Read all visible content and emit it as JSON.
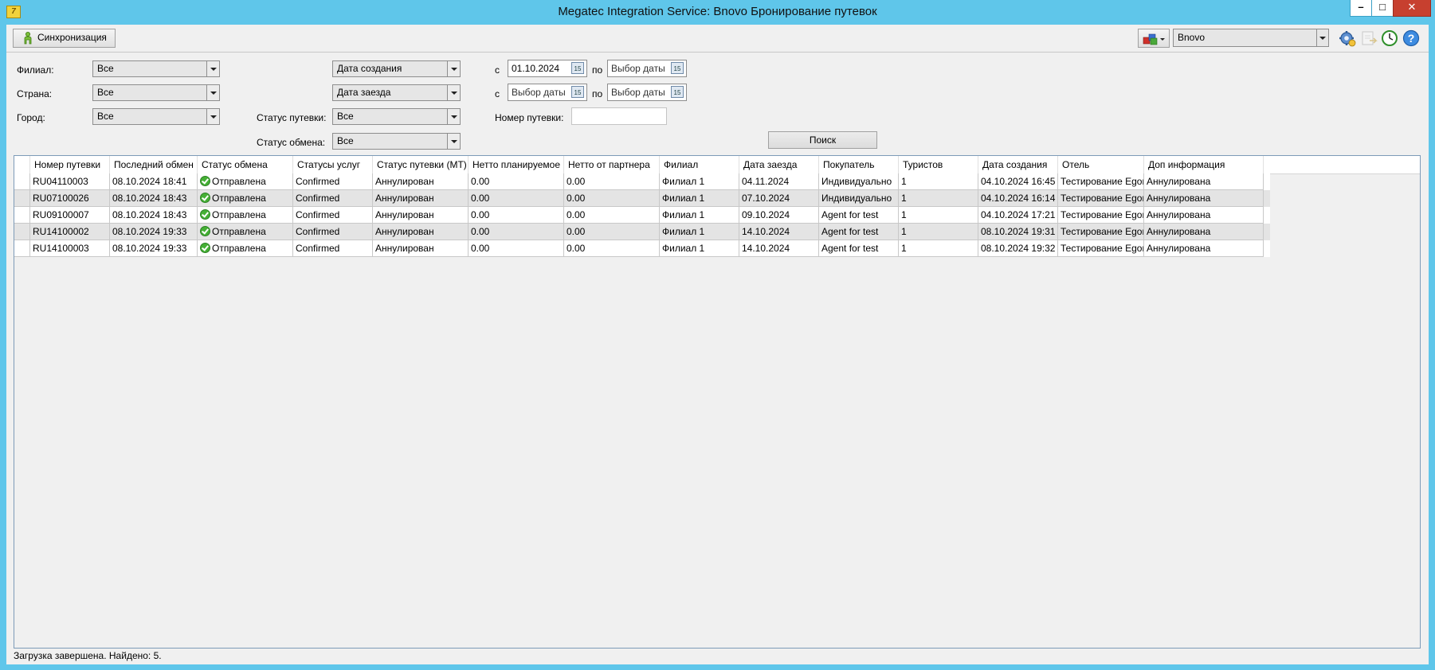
{
  "window": {
    "title": "Megatec Integration Service: Bnovo Бронирование путевок",
    "app_icon_glyph": "7",
    "minimize_glyph": "–",
    "maximize_glyph": "□",
    "close_glyph": "✕"
  },
  "toolbar": {
    "sync_label": "Синхронизация",
    "service_select": "Bnovo"
  },
  "filters": {
    "branch_label": "Филиал:",
    "branch_value": "Все",
    "country_label": "Страна:",
    "country_value": "Все",
    "city_label": "Город:",
    "city_value": "Все",
    "date_type1_value": "Дата создания",
    "date_type2_value": "Дата заезда",
    "tour_status_label": "Статус путевки:",
    "tour_status_value": "Все",
    "exchange_status_label": "Статус обмена:",
    "exchange_status_value": "Все",
    "from_label": "с",
    "to_label": "по",
    "date1_from": "01.10.2024",
    "date1_to": "Выбор даты",
    "date2_from": "Выбор даты",
    "date2_to": "Выбор даты",
    "calendar_glyph": "15",
    "tour_number_label": "Номер путевки:",
    "tour_number_value": "",
    "search_label": "Поиск"
  },
  "grid": {
    "columns": [
      "Номер путевки",
      "Последний обмен",
      "Статус обмена",
      "Статусы услуг",
      "Статус путевки (МТ)",
      "Нетто планируемое",
      "Нетто от партнера",
      "Филиал",
      "Дата заезда",
      "Покупатель",
      "Туристов",
      "Дата создания",
      "Отель",
      "Доп информация"
    ],
    "rows": [
      [
        "RU04110003",
        "08.10.2024 18:41",
        "Отправлена",
        "Confirmed",
        "Аннулирован",
        "0.00",
        "0.00",
        "Филиал 1",
        "04.11.2024",
        "Индивидуально",
        "1",
        "04.10.2024 16:45",
        "Тестирование Egor",
        "Аннулирована"
      ],
      [
        "RU07100026",
        "08.10.2024 18:43",
        "Отправлена",
        "Confirmed",
        "Аннулирован",
        "0.00",
        "0.00",
        "Филиал 1",
        "07.10.2024",
        "Индивидуально",
        "1",
        "04.10.2024 16:14",
        "Тестирование Egor",
        "Аннулирована"
      ],
      [
        "RU09100007",
        "08.10.2024 18:43",
        "Отправлена",
        "Confirmed",
        "Аннулирован",
        "0.00",
        "0.00",
        "Филиал 1",
        "09.10.2024",
        "Agent for test",
        "1",
        "04.10.2024 17:21",
        "Тестирование Egor",
        "Аннулирована"
      ],
      [
        "RU14100002",
        "08.10.2024 19:33",
        "Отправлена",
        "Confirmed",
        "Аннулирован",
        "0.00",
        "0.00",
        "Филиал 1",
        "14.10.2024",
        "Agent for test",
        "1",
        "08.10.2024 19:31",
        "Тестирование Egor",
        "Аннулирована"
      ],
      [
        "RU14100003",
        "08.10.2024 19:33",
        "Отправлена",
        "Confirmed",
        "Аннулирован",
        "0.00",
        "0.00",
        "Филиал 1",
        "14.10.2024",
        "Agent for test",
        "1",
        "08.10.2024 19:32",
        "Тестирование Egor",
        "Аннулирована"
      ]
    ]
  },
  "status_bar": {
    "text": "Загрузка завершена. Найдено: 5."
  },
  "icons": {
    "app": "megatec-app-icon",
    "sync": "sync-person-icon",
    "service": "colored-blocks-icon",
    "settings": "gear-icon",
    "disabled_action": "document-arrow-icon",
    "schedule": "clock-icon",
    "help": "help-icon"
  }
}
